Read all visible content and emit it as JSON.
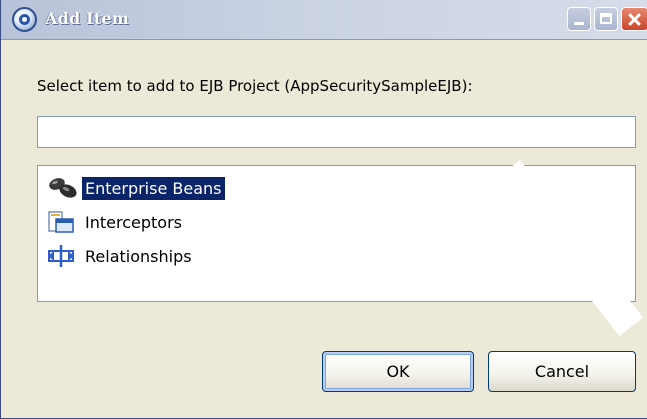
{
  "window": {
    "title": "Add Item"
  },
  "dialog": {
    "prompt": "Select item to add to EJB Project (AppSecuritySampleEJB):",
    "filter_value": "",
    "items": [
      {
        "label": "Enterprise Beans",
        "icon": "enterprise-beans-icon",
        "selected": true
      },
      {
        "label": "Interceptors",
        "icon": "interceptors-icon",
        "selected": false
      },
      {
        "label": "Relationships",
        "icon": "relationships-icon",
        "selected": false
      }
    ]
  },
  "buttons": {
    "ok_label": "OK",
    "cancel_label": "Cancel"
  },
  "colors": {
    "selection_bg": "#0a246a",
    "dialog_bg": "#ece9d8",
    "input_border": "#7f9db9"
  }
}
